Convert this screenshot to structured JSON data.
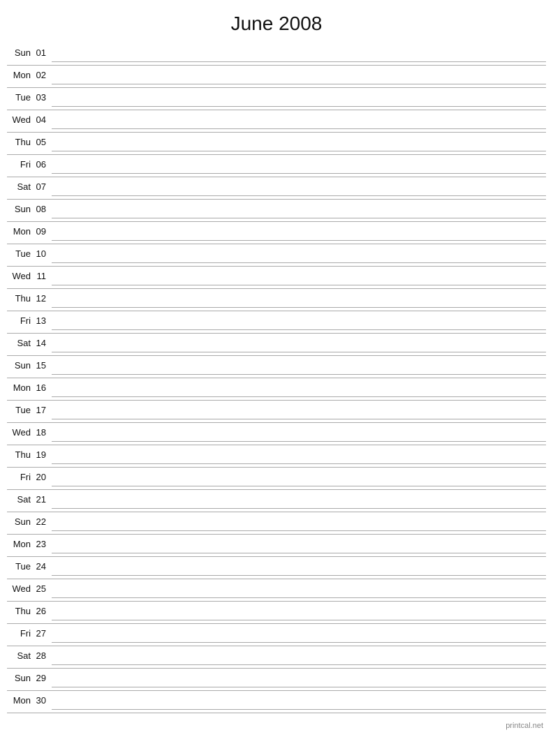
{
  "title": "June 2008",
  "footer": "printcal.net",
  "days": [
    {
      "name": "Sun",
      "num": "01"
    },
    {
      "name": "Mon",
      "num": "02"
    },
    {
      "name": "Tue",
      "num": "03"
    },
    {
      "name": "Wed",
      "num": "04"
    },
    {
      "name": "Thu",
      "num": "05"
    },
    {
      "name": "Fri",
      "num": "06"
    },
    {
      "name": "Sat",
      "num": "07"
    },
    {
      "name": "Sun",
      "num": "08"
    },
    {
      "name": "Mon",
      "num": "09"
    },
    {
      "name": "Tue",
      "num": "10"
    },
    {
      "name": "Wed",
      "num": "11"
    },
    {
      "name": "Thu",
      "num": "12"
    },
    {
      "name": "Fri",
      "num": "13"
    },
    {
      "name": "Sat",
      "num": "14"
    },
    {
      "name": "Sun",
      "num": "15"
    },
    {
      "name": "Mon",
      "num": "16"
    },
    {
      "name": "Tue",
      "num": "17"
    },
    {
      "name": "Wed",
      "num": "18"
    },
    {
      "name": "Thu",
      "num": "19"
    },
    {
      "name": "Fri",
      "num": "20"
    },
    {
      "name": "Sat",
      "num": "21"
    },
    {
      "name": "Sun",
      "num": "22"
    },
    {
      "name": "Mon",
      "num": "23"
    },
    {
      "name": "Tue",
      "num": "24"
    },
    {
      "name": "Wed",
      "num": "25"
    },
    {
      "name": "Thu",
      "num": "26"
    },
    {
      "name": "Fri",
      "num": "27"
    },
    {
      "name": "Sat",
      "num": "28"
    },
    {
      "name": "Sun",
      "num": "29"
    },
    {
      "name": "Mon",
      "num": "30"
    }
  ]
}
